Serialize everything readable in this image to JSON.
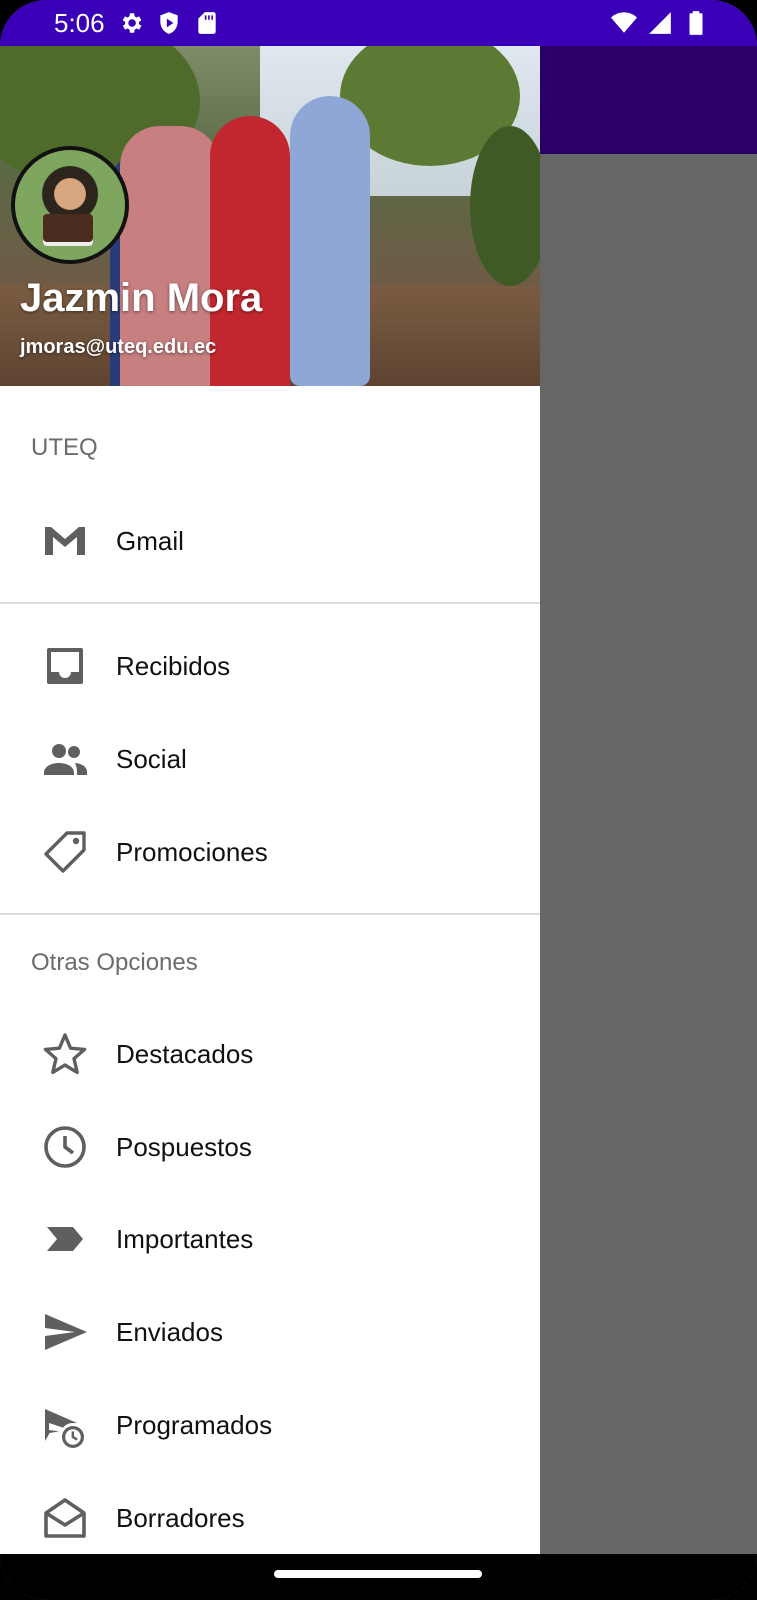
{
  "status_bar": {
    "time": "5:06",
    "left_icons": [
      "gear-icon",
      "shield-play-icon",
      "sd-card-icon"
    ],
    "right_icons": [
      "wifi-icon",
      "signal-icon",
      "battery-icon"
    ],
    "background": "#3a00b8"
  },
  "header": {
    "name": "Jazmin Mora",
    "email": "jmoras@uteq.edu.ec"
  },
  "sections": {
    "uteq": "UTEQ",
    "other": "Otras Opciones"
  },
  "menu": {
    "gmail": {
      "label": "Gmail",
      "icon": "gmail-icon"
    },
    "recibidos": {
      "label": "Recibidos",
      "icon": "inbox-icon"
    },
    "social": {
      "label": "Social",
      "icon": "people-icon"
    },
    "promociones": {
      "label": "Promociones",
      "icon": "tag-icon"
    },
    "destacados": {
      "label": "Destacados",
      "icon": "star-icon"
    },
    "pospuestos": {
      "label": "Pospuestos",
      "icon": "clock-icon"
    },
    "importantes": {
      "label": "Importantes",
      "icon": "label-important-icon"
    },
    "enviados": {
      "label": "Enviados",
      "icon": "send-icon"
    },
    "programados": {
      "label": "Programados",
      "icon": "schedule-send-icon"
    },
    "borradores": {
      "label": "Borradores",
      "icon": "draft-icon"
    }
  },
  "colors": {
    "app_bar": "#2a0066",
    "scrim": "#666666",
    "icon": "#5f5f5f"
  }
}
